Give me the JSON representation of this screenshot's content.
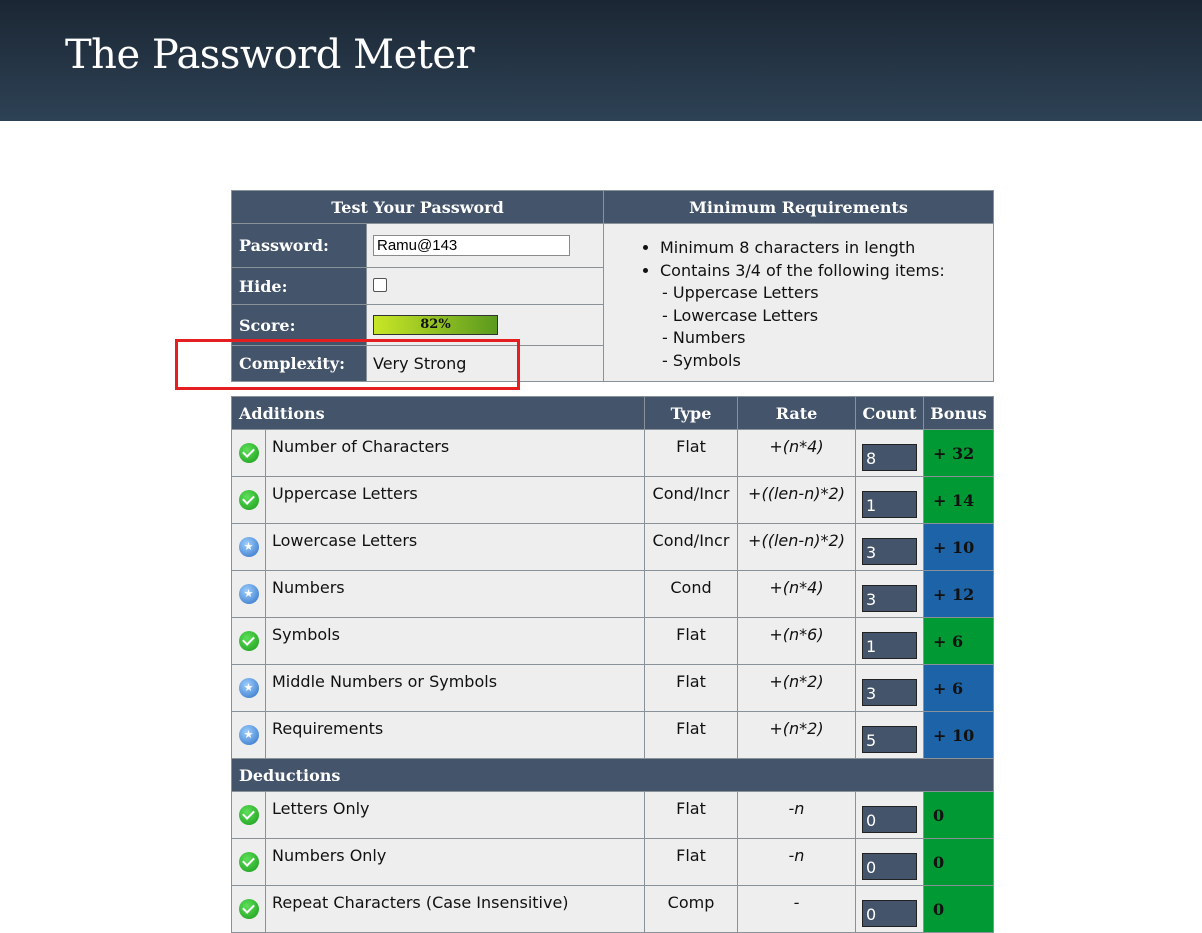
{
  "header": {
    "title": "The Password Meter"
  },
  "test_panel": {
    "heading": "Test Your Password",
    "password_label": "Password:",
    "password_value": "Ramu@143",
    "hide_label": "Hide:",
    "score_label": "Score:",
    "score_text": "82%",
    "score_value": 82,
    "complexity_label": "Complexity:",
    "complexity_value": "Very Strong"
  },
  "requirements": {
    "heading": "Minimum Requirements",
    "items": [
      "Minimum 8 characters in length",
      "Contains 3/4 of the following items:"
    ],
    "sub_items": [
      "- Uppercase Letters",
      "- Lowercase Letters",
      "- Numbers",
      "- Symbols"
    ]
  },
  "table": {
    "headers": {
      "additions": "Additions",
      "type": "Type",
      "rate": "Rate",
      "count": "Count",
      "bonus": "Bonus"
    },
    "additions": [
      {
        "icon": "check-icon",
        "name": "Number of Characters",
        "type": "Flat",
        "rate": "+(n*4)",
        "count": "8",
        "bonus": "+ 32",
        "color": "#009933"
      },
      {
        "icon": "check-icon",
        "name": "Uppercase Letters",
        "type": "Cond/Incr",
        "rate": "+((len-n)*2)",
        "count": "1",
        "bonus": "+ 14",
        "color": "#009933"
      },
      {
        "icon": "star-icon",
        "name": "Lowercase Letters",
        "type": "Cond/Incr",
        "rate": "+((len-n)*2)",
        "count": "3",
        "bonus": "+ 10",
        "color": "#1c63a8"
      },
      {
        "icon": "star-icon",
        "name": "Numbers",
        "type": "Cond",
        "rate": "+(n*4)",
        "count": "3",
        "bonus": "+ 12",
        "color": "#1c63a8"
      },
      {
        "icon": "check-icon",
        "name": "Symbols",
        "type": "Flat",
        "rate": "+(n*6)",
        "count": "1",
        "bonus": "+ 6",
        "color": "#009933"
      },
      {
        "icon": "star-icon",
        "name": "Middle Numbers or Symbols",
        "type": "Flat",
        "rate": "+(n*2)",
        "count": "3",
        "bonus": "+ 6",
        "color": "#1c63a8"
      },
      {
        "icon": "star-icon",
        "name": "Requirements",
        "type": "Flat",
        "rate": "+(n*2)",
        "count": "5",
        "bonus": "+ 10",
        "color": "#1c63a8"
      }
    ],
    "deductions_heading": "Deductions",
    "deductions": [
      {
        "icon": "check-icon",
        "name": "Letters Only",
        "type": "Flat",
        "rate": "-n",
        "count": "0",
        "bonus": "0",
        "color": "#009933"
      },
      {
        "icon": "check-icon",
        "name": "Numbers Only",
        "type": "Flat",
        "rate": "-n",
        "count": "0",
        "bonus": "0",
        "color": "#009933"
      },
      {
        "icon": "check-icon",
        "name": "Repeat Characters (Case Insensitive)",
        "type": "Comp",
        "rate": "-",
        "count": "0",
        "bonus": "0",
        "color": "#009933"
      }
    ]
  }
}
